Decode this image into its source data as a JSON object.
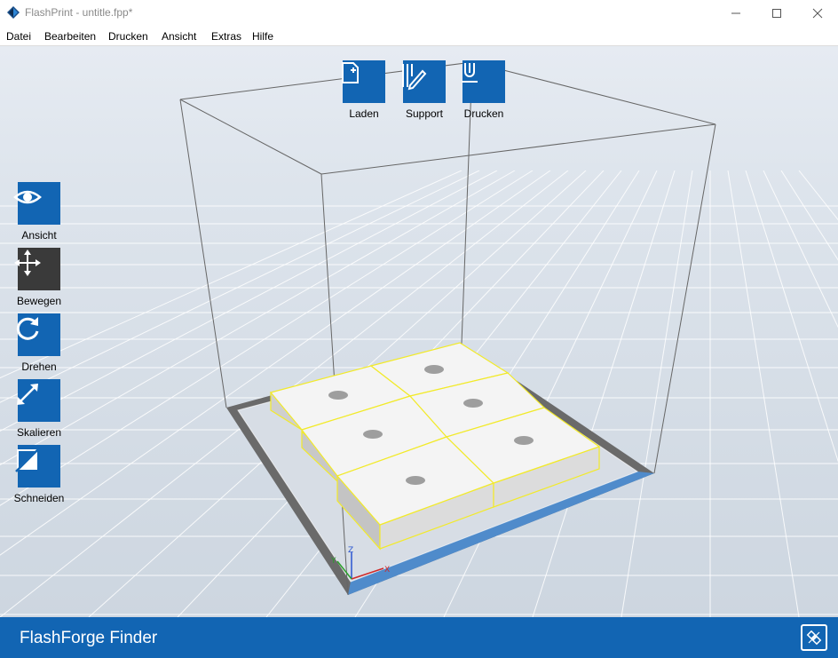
{
  "window": {
    "title": "FlashPrint - untitle.fpp*"
  },
  "menu": [
    "Datei",
    "Bearbeiten",
    "Drucken",
    "Ansicht",
    "Extras",
    "Hilfe"
  ],
  "top_toolbar": [
    {
      "label": "Laden",
      "icon": "load-file-icon"
    },
    {
      "label": "Support",
      "icon": "support-icon"
    },
    {
      "label": "Drucken",
      "icon": "print-icon"
    }
  ],
  "left_toolbar": [
    {
      "label": "Ansicht",
      "icon": "eye-icon"
    },
    {
      "label": "Bewegen",
      "icon": "move-icon",
      "active": true
    },
    {
      "label": "Drehen",
      "icon": "rotate-icon"
    },
    {
      "label": "Skalieren",
      "icon": "scale-icon"
    },
    {
      "label": "Schneiden",
      "icon": "cut-icon"
    }
  ],
  "axes": {
    "x": "X",
    "y": "Y",
    "z": "Z"
  },
  "statusbar": {
    "printer": "FlashForge Finder",
    "connect_icon": "connect-icon"
  },
  "colors": {
    "accent": "#1265b3",
    "selection": "#f2ea2a",
    "model": "#f2f2f2"
  }
}
